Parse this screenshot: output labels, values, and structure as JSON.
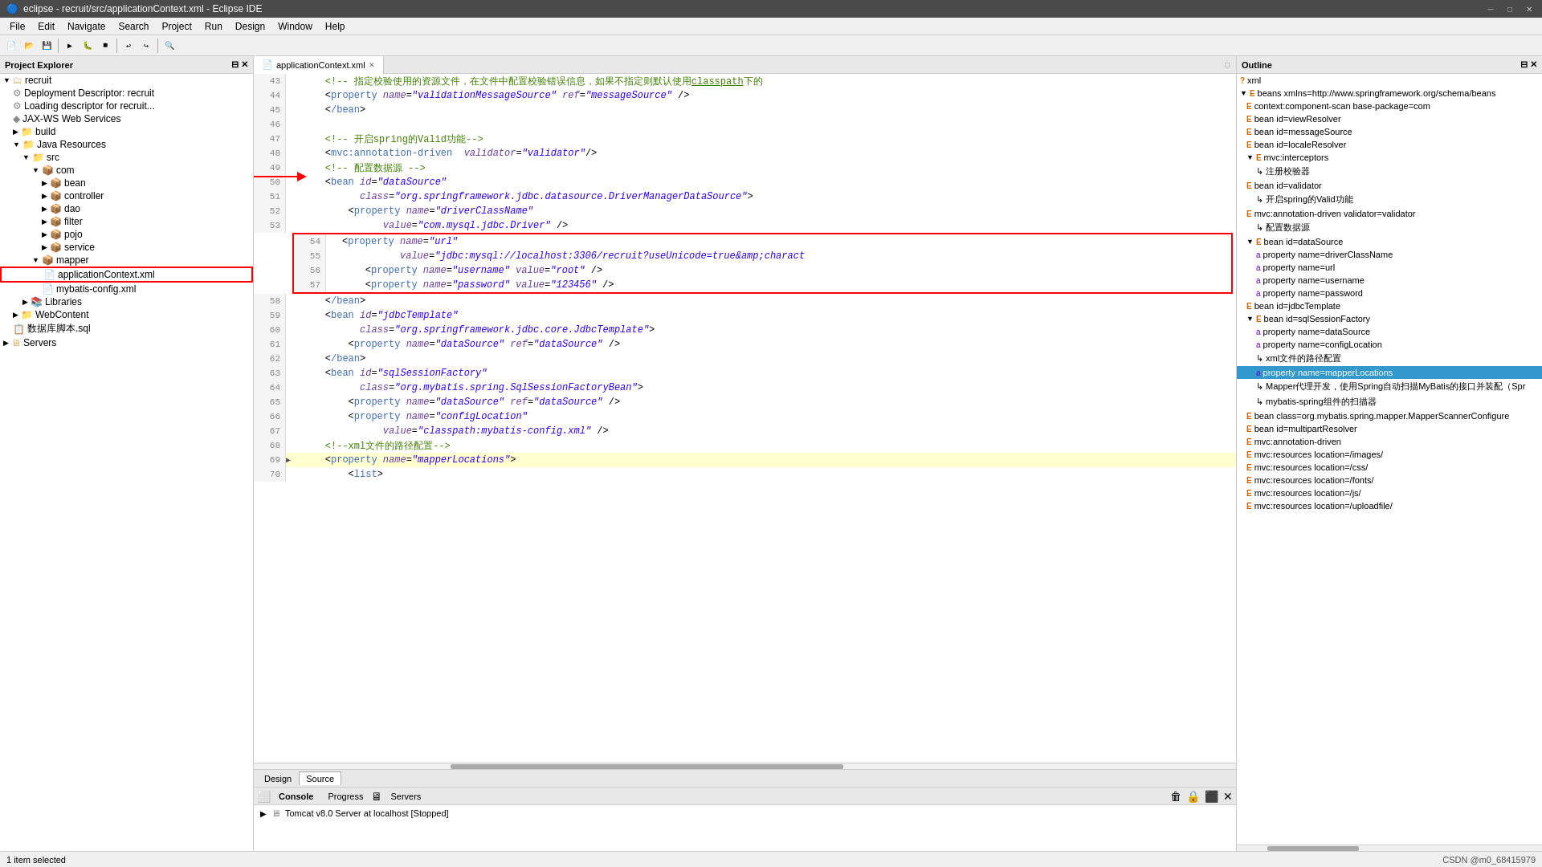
{
  "titlebar": {
    "title": "eclipse - recruit/src/applicationContext.xml - Eclipse IDE",
    "minimize": "─",
    "maximize": "□",
    "close": "✕"
  },
  "menubar": {
    "items": [
      "File",
      "Edit",
      "Navigate",
      "Search",
      "Project",
      "Run",
      "Design",
      "Window",
      "Help"
    ]
  },
  "project_explorer": {
    "title": "Project Explorer",
    "items": [
      {
        "id": "recruit",
        "label": "recruit",
        "indent": 0,
        "type": "project"
      },
      {
        "id": "deployment",
        "label": "Deployment Descriptor: recruit",
        "indent": 1,
        "type": "config"
      },
      {
        "id": "loading",
        "label": "Loading descriptor for recruit...",
        "indent": 1,
        "type": "config"
      },
      {
        "id": "jax",
        "label": "JAX-WS Web Services",
        "indent": 1,
        "type": "service"
      },
      {
        "id": "build",
        "label": "build",
        "indent": 1,
        "type": "folder"
      },
      {
        "id": "java-resources",
        "label": "Java Resources",
        "indent": 1,
        "type": "folder"
      },
      {
        "id": "src",
        "label": "src",
        "indent": 2,
        "type": "folder"
      },
      {
        "id": "com",
        "label": "com",
        "indent": 3,
        "type": "pkg"
      },
      {
        "id": "bean",
        "label": "bean",
        "indent": 4,
        "type": "pkg"
      },
      {
        "id": "controller",
        "label": "controller",
        "indent": 4,
        "type": "pkg"
      },
      {
        "id": "dao",
        "label": "dao",
        "indent": 4,
        "type": "pkg"
      },
      {
        "id": "filter",
        "label": "filter",
        "indent": 4,
        "type": "pkg"
      },
      {
        "id": "pojo",
        "label": "pojo",
        "indent": 4,
        "type": "pkg"
      },
      {
        "id": "service",
        "label": "service",
        "indent": 4,
        "type": "pkg"
      },
      {
        "id": "mapper",
        "label": "mapper",
        "indent": 3,
        "type": "pkg"
      },
      {
        "id": "applicationContext",
        "label": "applicationContext.xml",
        "indent": 4,
        "type": "xml",
        "selected": true,
        "redbox": true
      },
      {
        "id": "mybatis-config",
        "label": "mybatis-config.xml",
        "indent": 4,
        "type": "xml"
      },
      {
        "id": "libraries",
        "label": "Libraries",
        "indent": 2,
        "type": "folder"
      },
      {
        "id": "webcontent",
        "label": "WebContent",
        "indent": 1,
        "type": "folder"
      },
      {
        "id": "dbscript",
        "label": "数据库脚本.sql",
        "indent": 1,
        "type": "sql"
      },
      {
        "id": "servers",
        "label": "Servers",
        "indent": 0,
        "type": "folder"
      }
    ]
  },
  "editor": {
    "tab_label": "applicationContext.xml",
    "lines": [
      {
        "num": 43,
        "arrow": false,
        "content": "    <!-- 指定校验使用的资源文件，在文件中配置校验错误信息，如果不指定则默认使用classpath下的",
        "type": "comment"
      },
      {
        "num": 44,
        "arrow": false,
        "content": "    <property name=\"validationMessageSource\" ref=\"messageSource\" />",
        "type": "tag"
      },
      {
        "num": 45,
        "arrow": false,
        "content": "    </bean>",
        "type": "tag"
      },
      {
        "num": 46,
        "arrow": false,
        "content": "",
        "type": "blank"
      },
      {
        "num": 47,
        "arrow": false,
        "content": "    <!-- 开启spring的Valid功能-->",
        "type": "comment"
      },
      {
        "num": 48,
        "arrow": false,
        "content": "    <mvc:annotation-driven  validator=\"validator\"/>",
        "type": "tag"
      },
      {
        "num": 49,
        "arrow": false,
        "content": "    <!-- 配置数据源 -->",
        "type": "comment"
      },
      {
        "num": 50,
        "arrow": false,
        "content": "    <bean id=\"dataSource\"",
        "type": "tag"
      },
      {
        "num": 51,
        "arrow": false,
        "content": "          class=\"org.springframework.jdbc.datasource.DriverManagerDataSource\">",
        "type": "tag"
      },
      {
        "num": 52,
        "arrow": false,
        "content": "        <property name=\"driverClassName\"",
        "type": "tag"
      },
      {
        "num": 53,
        "arrow": false,
        "content": "              value=\"com.mysql.jdbc.Driver\" />",
        "type": "tag"
      },
      {
        "num": 54,
        "arrow": false,
        "content": "    <property name=\"url\"",
        "type": "tag",
        "redbox_start": true
      },
      {
        "num": 55,
        "arrow": false,
        "content": "          value=\"jdbc:mysql://localhost:3306/recruit?useUnicode=true&amp;charact",
        "type": "tag"
      },
      {
        "num": 56,
        "arrow": false,
        "content": "    <property name=\"username\" value=\"root\" />",
        "type": "tag"
      },
      {
        "num": 57,
        "arrow": false,
        "content": "    <property name=\"password\" value=\"123456\" />",
        "type": "tag",
        "redbox_end": true
      },
      {
        "num": 58,
        "arrow": false,
        "content": "    </bean>",
        "type": "tag"
      },
      {
        "num": 59,
        "arrow": false,
        "content": "    <bean id=\"jdbcTemplate\"",
        "type": "tag"
      },
      {
        "num": 60,
        "arrow": false,
        "content": "          class=\"org.springframework.jdbc.core.JdbcTemplate\">",
        "type": "tag"
      },
      {
        "num": 61,
        "arrow": false,
        "content": "        <property name=\"dataSource\" ref=\"dataSource\" />",
        "type": "tag"
      },
      {
        "num": 62,
        "arrow": false,
        "content": "    </bean>",
        "type": "tag"
      },
      {
        "num": 63,
        "arrow": false,
        "content": "    <bean id=\"sqlSessionFactory\"",
        "type": "tag"
      },
      {
        "num": 64,
        "arrow": false,
        "content": "          class=\"org.mybatis.spring.SqlSessionFactoryBean\">",
        "type": "tag"
      },
      {
        "num": 65,
        "arrow": false,
        "content": "        <property name=\"dataSource\" ref=\"dataSource\" />",
        "type": "tag"
      },
      {
        "num": 66,
        "arrow": false,
        "content": "        <property name=\"configLocation\"",
        "type": "tag"
      },
      {
        "num": 67,
        "arrow": false,
        "content": "              value=\"classpath:mybatis-config.xml\" />",
        "type": "tag"
      },
      {
        "num": 68,
        "arrow": false,
        "content": "    <!--xml文件的路径配置-->",
        "type": "comment"
      },
      {
        "num": 69,
        "arrow": true,
        "content": "    <property name=\"mapperLocations\">",
        "type": "tag",
        "current": true
      },
      {
        "num": 70,
        "arrow": false,
        "content": "        <list>",
        "type": "tag"
      }
    ],
    "design_tab": "Design",
    "source_tab": "Source",
    "active_tab": "Source"
  },
  "console": {
    "tabs": [
      "Console",
      "Progress",
      "Servers"
    ],
    "active_tab": "Console",
    "content": "Tomcat v8.0 Server at localhost  [Stopped]"
  },
  "outline": {
    "title": "Outline",
    "items": [
      {
        "label": "xml",
        "indent": 0,
        "type": "e"
      },
      {
        "label": "beans xmlns=http://www.springframework.org/schema/beans",
        "indent": 0,
        "type": "e"
      },
      {
        "label": "context:component-scan base-package=com",
        "indent": 1,
        "type": "e"
      },
      {
        "label": "bean id=viewResolver",
        "indent": 1,
        "type": "e"
      },
      {
        "label": "bean id=messageSource",
        "indent": 1,
        "type": "e"
      },
      {
        "label": "bean id=localeResolver",
        "indent": 1,
        "type": "e"
      },
      {
        "label": "mvc:interceptors",
        "indent": 1,
        "type": "e"
      },
      {
        "label": "注册校验器",
        "indent": 2,
        "type": "leaf"
      },
      {
        "label": "bean id=validator",
        "indent": 1,
        "type": "e"
      },
      {
        "label": "开启spring的Valid功能",
        "indent": 2,
        "type": "leaf"
      },
      {
        "label": "mvc:annotation-driven validator=validator",
        "indent": 1,
        "type": "e"
      },
      {
        "label": "配置数据源",
        "indent": 2,
        "type": "leaf"
      },
      {
        "label": "bean id=dataSource",
        "indent": 1,
        "type": "e"
      },
      {
        "label": "property name=driverClassName",
        "indent": 2,
        "type": "attr"
      },
      {
        "label": "property name=url",
        "indent": 2,
        "type": "attr"
      },
      {
        "label": "property name=username",
        "indent": 2,
        "type": "attr"
      },
      {
        "label": "property name=password",
        "indent": 2,
        "type": "attr"
      },
      {
        "label": "bean id=jdbcTemplate",
        "indent": 1,
        "type": "e"
      },
      {
        "label": "bean id=sqlSessionFactory",
        "indent": 1,
        "type": "e"
      },
      {
        "label": "property name=dataSource",
        "indent": 2,
        "type": "attr"
      },
      {
        "label": "property name=configLocation",
        "indent": 2,
        "type": "attr"
      },
      {
        "label": "xml文件的路径配置",
        "indent": 2,
        "type": "leaf"
      },
      {
        "label": "property name=mapperLocations",
        "indent": 2,
        "type": "attr",
        "selected": true
      },
      {
        "label": "Mapper代理开发，使用Spring自动扫描MyBatis的接口并装配（Spr",
        "indent": 2,
        "type": "leaf"
      },
      {
        "label": "mybatis-spring组件的扫描器",
        "indent": 2,
        "type": "leaf"
      },
      {
        "label": "bean class=org.mybatis.spring.mapper.MapperScannerConfigure",
        "indent": 1,
        "type": "e"
      },
      {
        "label": "bean id=multipartResolver",
        "indent": 1,
        "type": "e"
      },
      {
        "label": "mvc:annotation-driven",
        "indent": 1,
        "type": "e"
      },
      {
        "label": "mvc:resources location=/images/",
        "indent": 1,
        "type": "e"
      },
      {
        "label": "mvc:resources location=/css/",
        "indent": 1,
        "type": "e"
      },
      {
        "label": "mvc:resources location=/fonts/",
        "indent": 1,
        "type": "e"
      },
      {
        "label": "mvc:resources location=/js/",
        "indent": 1,
        "type": "e"
      },
      {
        "label": "mvc:resources location=/uploadfile/",
        "indent": 1,
        "type": "e"
      }
    ]
  },
  "statusbar": {
    "left": "1 item selected",
    "right": "CSDN @m0_68415979"
  }
}
